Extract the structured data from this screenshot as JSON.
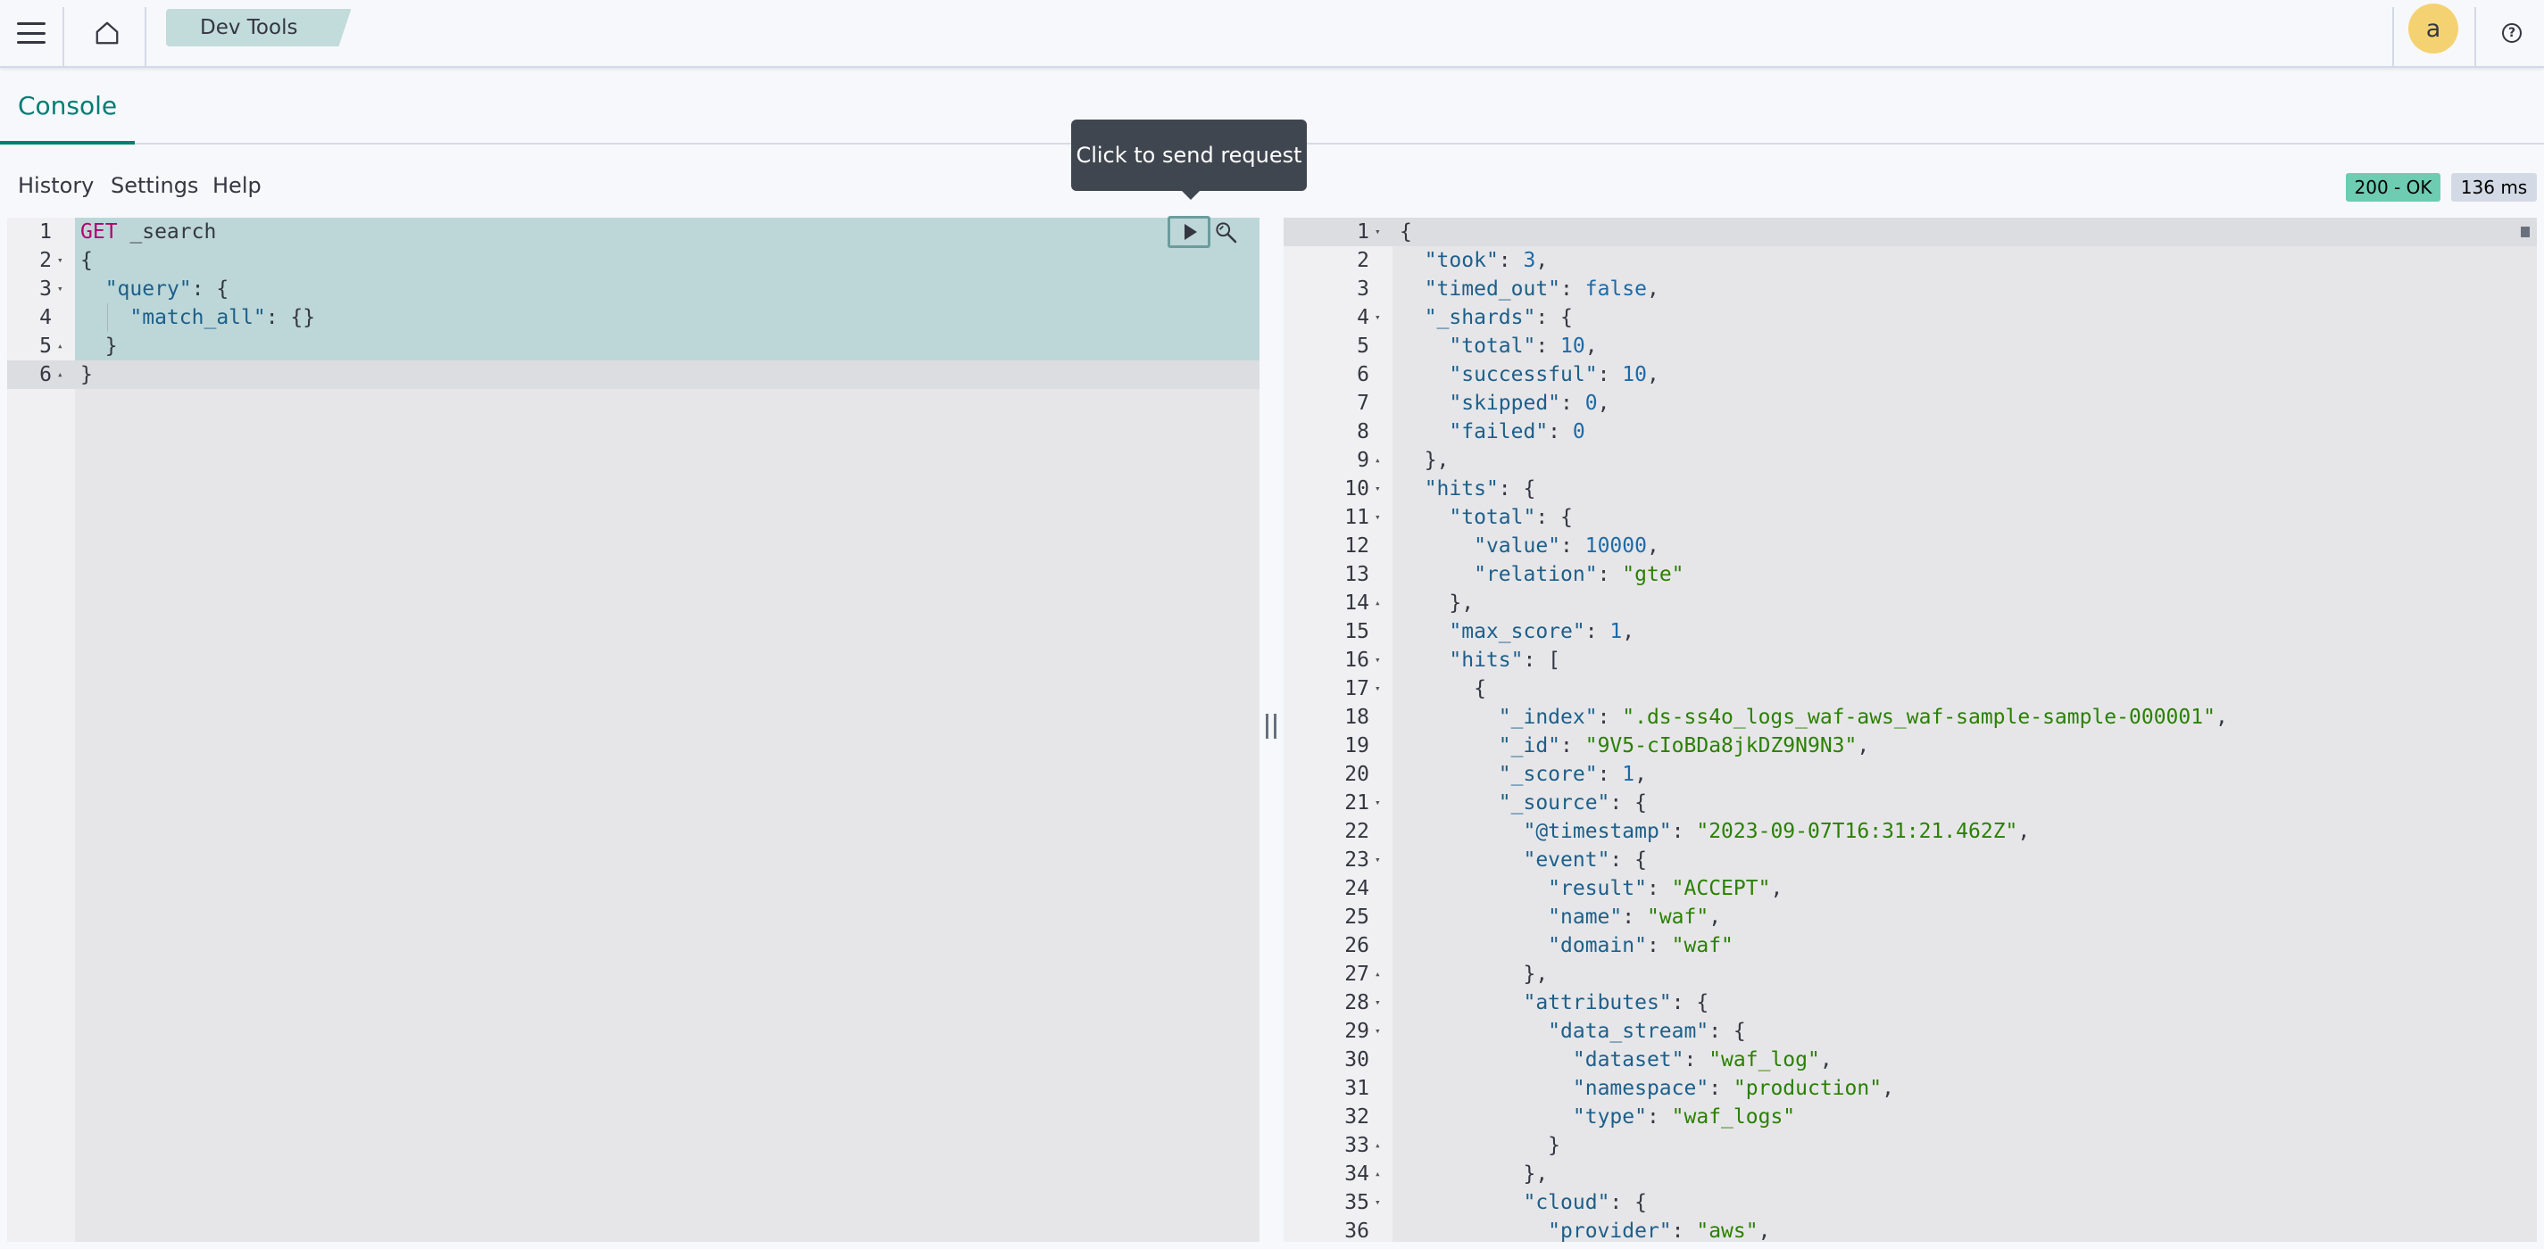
{
  "header": {
    "breadcrumb": "Dev Tools",
    "avatar_initial": "a",
    "help_glyph": "?"
  },
  "tabs": {
    "console_label": "Console"
  },
  "toolbar": {
    "history_label": "History",
    "settings_label": "Settings",
    "help_label": "Help"
  },
  "status": {
    "code": "200 - OK",
    "time": "136 ms"
  },
  "tooltip": {
    "text": "Click to send request"
  },
  "request_lines": [
    "GET _search",
    "{",
    "  \"query\": {",
    "    \"match_all\": {}",
    "  }",
    "}"
  ],
  "response_lines": [
    "{",
    "  \"took\": 3,",
    "  \"timed_out\": false,",
    "  \"_shards\": {",
    "    \"total\": 10,",
    "    \"successful\": 10,",
    "    \"skipped\": 0,",
    "    \"failed\": 0",
    "  },",
    "  \"hits\": {",
    "    \"total\": {",
    "      \"value\": 10000,",
    "      \"relation\": \"gte\"",
    "    },",
    "    \"max_score\": 1,",
    "    \"hits\": [",
    "      {",
    "        \"_index\": \".ds-ss4o_logs_waf-aws_waf-sample-sample-000001\",",
    "        \"_id\": \"9V5-cIoBDa8jkDZ9N9N3\",",
    "        \"_score\": 1,",
    "        \"_source\": {",
    "          \"@timestamp\": \"2023-09-07T16:31:21.462Z\",",
    "          \"event\": {",
    "            \"result\": \"ACCEPT\",",
    "            \"name\": \"waf\",",
    "            \"domain\": \"waf\"",
    "          },",
    "          \"attributes\": {",
    "            \"data_stream\": {",
    "              \"dataset\": \"waf_log\",",
    "              \"namespace\": \"production\",",
    "              \"type\": \"waf_logs\"",
    "            }",
    "          },",
    "          \"cloud\": {",
    "            \"provider\": \"aws\","
  ]
}
